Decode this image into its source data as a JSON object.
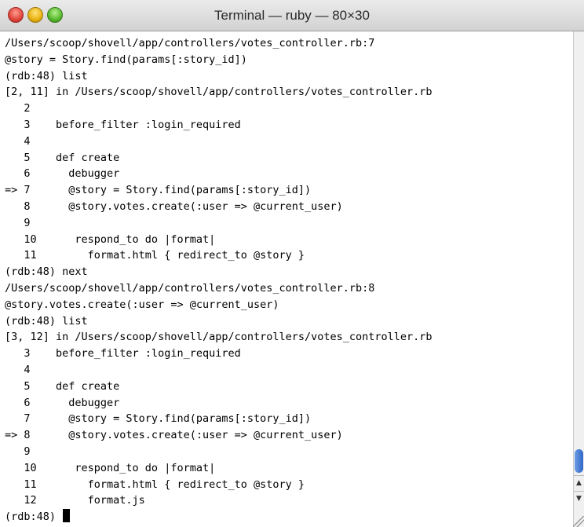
{
  "window": {
    "title": "Terminal — ruby — 80×30"
  },
  "controls": {
    "close_icon": "close-circle",
    "minimize_icon": "minimize-circle",
    "zoom_icon": "zoom-circle"
  },
  "terminal": {
    "lines": [
      "/Users/scoop/shovell/app/controllers/votes_controller.rb:7",
      "@story = Story.find(params[:story_id])",
      "(rdb:48) list",
      "[2, 11] in /Users/scoop/shovell/app/controllers/votes_controller.rb",
      "   2",
      "   3    before_filter :login_required",
      "   4",
      "   5    def create",
      "   6      debugger",
      "=> 7      @story = Story.find(params[:story_id])",
      "   8      @story.votes.create(:user => @current_user)",
      "   9",
      "   10      respond_to do |format|",
      "   11        format.html { redirect_to @story }",
      "(rdb:48) next",
      "/Users/scoop/shovell/app/controllers/votes_controller.rb:8",
      "@story.votes.create(:user => @current_user)",
      "(rdb:48) list",
      "[3, 12] in /Users/scoop/shovell/app/controllers/votes_controller.rb",
      "   3    before_filter :login_required",
      "   4",
      "   5    def create",
      "   6      debugger",
      "   7      @story = Story.find(params[:story_id])",
      "=> 8      @story.votes.create(:user => @current_user)",
      "   9",
      "   10      respond_to do |format|",
      "   11        format.html { redirect_to @story }",
      "   12        format.js"
    ],
    "prompt": "(rdb:48) "
  },
  "scrollbar": {
    "up_arrow": "▲",
    "down_arrow": "▼"
  }
}
